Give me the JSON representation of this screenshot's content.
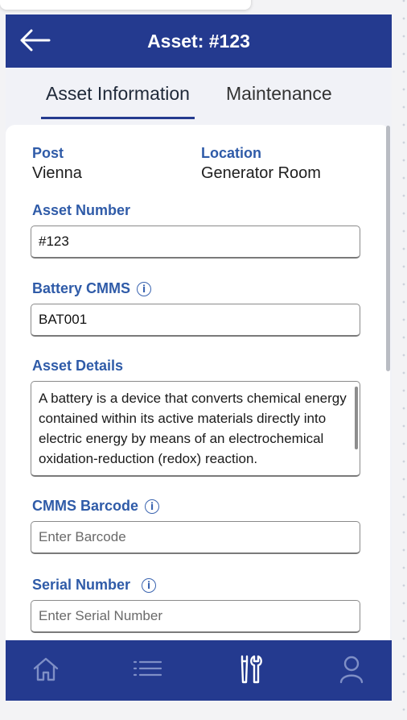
{
  "header": {
    "title": "Asset: #123"
  },
  "tabs": [
    {
      "label": "Asset Information"
    },
    {
      "label": "Maintenance"
    }
  ],
  "form": {
    "post": {
      "label": "Post",
      "value": "Vienna"
    },
    "location": {
      "label": "Location",
      "value": "Generator Room"
    },
    "asset_number": {
      "label": "Asset Number",
      "value": "#123"
    },
    "battery_cmms": {
      "label": "Battery CMMS",
      "value": "BAT001"
    },
    "asset_details": {
      "label": "Asset Details",
      "value": "A battery is a device that converts chemical energy contained within its active materials directly into electric energy by means of an electrochemical oxidation-reduction (redox) reaction."
    },
    "cmms_barcode": {
      "label": "CMMS Barcode",
      "placeholder": "Enter Barcode"
    },
    "serial_number": {
      "label": "Serial Number",
      "placeholder": "Enter Serial Number"
    }
  },
  "colors": {
    "primary": "#243a8f",
    "label": "#2f5ba8"
  },
  "nav": [
    {
      "icon": "home-icon"
    },
    {
      "icon": "list-icon"
    },
    {
      "icon": "tools-icon"
    },
    {
      "icon": "user-icon"
    }
  ]
}
